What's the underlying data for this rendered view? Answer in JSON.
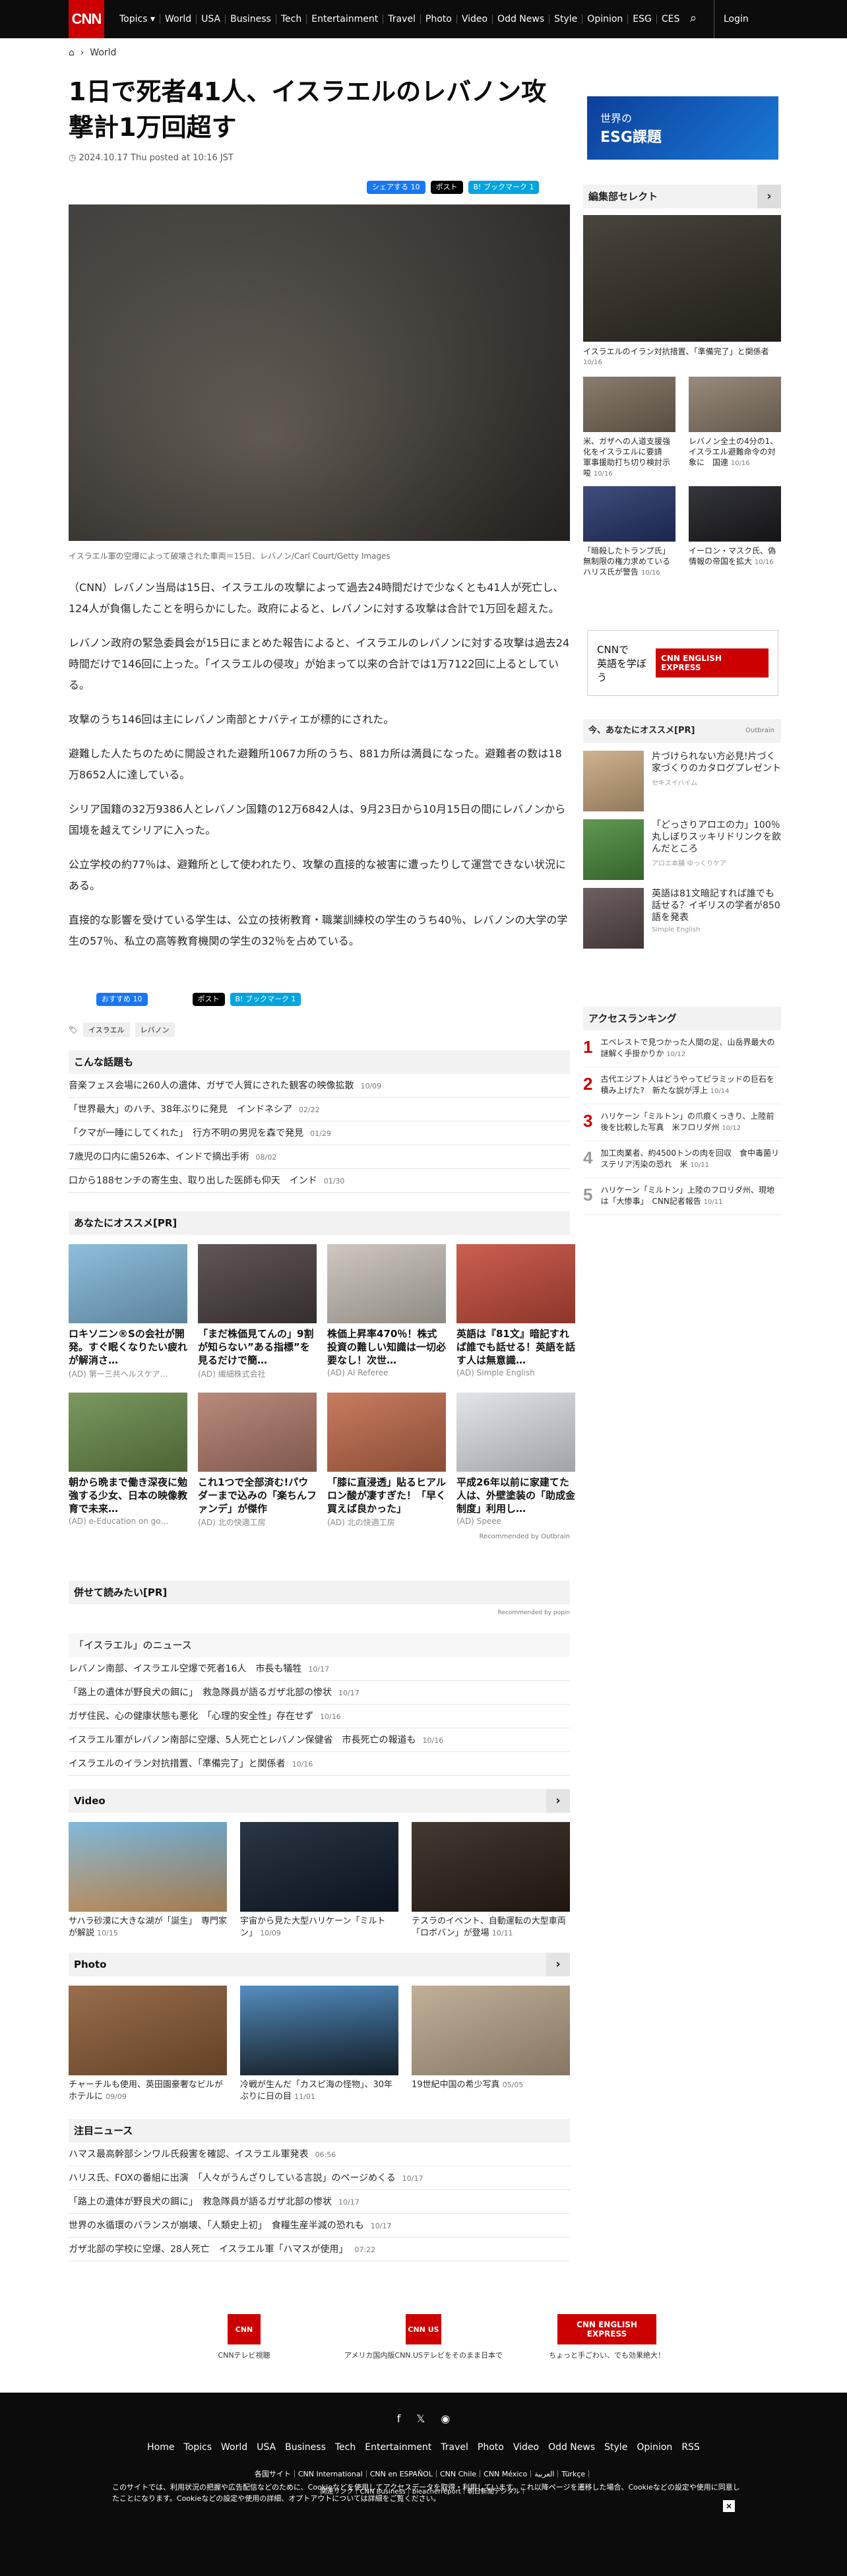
{
  "header": {
    "logo": "CNN",
    "nav": [
      "Topics",
      "World",
      "USA",
      "Business",
      "Tech",
      "Entertainment",
      "Travel",
      "Photo",
      "Video",
      "Odd News",
      "Style",
      "Opinion",
      "ESG",
      "CES"
    ],
    "login": "Login"
  },
  "breadcrumb": {
    "section": "World"
  },
  "article": {
    "title": "1日で死者41人、イスラエルのレバノン攻撃計1万回超す",
    "date": "2024.10.17 Thu posted at 10:16 JST",
    "share": {
      "facebook": "シェアする 10",
      "x": "ポスト",
      "hatena": "B! ブックマーク 1"
    },
    "caption": "イスラエル軍の空爆によって破壊された車両＝15日、レバノン/Carl Court/Getty Images",
    "paragraphs": [
      "（CNN）レバノン当局は15日、イスラエルの攻撃によって過去24時間だけで少なくとも41人が死亡し、124人が負傷したことを明らかにした。政府によると、レバノンに対する攻撃は合計で1万回を超えた。",
      "レバノン政府の緊急委員会が15日にまとめた報告によると、イスラエルのレバノンに対する攻撃は過去24時間だけで146回に上った。「イスラエルの侵攻」が始まって以来の合計では1万7122回に上るとしている。",
      "攻撃のうち146回は主にレバノン南部とナバティエが標的にされた。",
      "避難した人たちのために開設された避難所1067カ所のうち、881カ所は満員になった。避難者の数は18万8652人に達している。",
      "シリア国籍の32万9386人とレバノン国籍の12万6842人は、9月23日から10月15日の間にレバノンから国境を越えてシリアに入った。",
      "公立学校の約77％は、避難所として使われたり、攻撃の直接的な被害に遭ったりして運営できない状況にある。",
      "直接的な影響を受けている学生は、公立の技術教育・職業訓練校の学生のうち40％、レバノンの大学の学生の57％、私立の高等教育機関の学生の32％を占めている。"
    ],
    "share2": {
      "facebook": "おすすめ 10",
      "x": "ポスト",
      "hatena": "B! ブックマーク 1"
    },
    "tags": [
      "イスラエル",
      "レバノン"
    ]
  },
  "konna": {
    "heading": "こんな話題も",
    "items": [
      {
        "t": "音楽フェス会場に260人の遺体、ガザで人質にされた観客の映像拡散",
        "d": "10/09"
      },
      {
        "t": "「世界最大」のハチ、38年ぶりに発見　インドネシア",
        "d": "02/22"
      },
      {
        "t": "「クマが一睡にしてくれた」　行方不明の男児を森で発見",
        "d": "01/29"
      },
      {
        "t": "7歳児の口内に歯526本、インドで摘出手術",
        "d": "08/02"
      },
      {
        "t": "口から188センチの寄生虫、取り出した医師も仰天　インド",
        "d": "01/30"
      }
    ]
  },
  "osusume": {
    "heading": "あなたにオススメ[PR]",
    "cards": [
      {
        "t": "ロキソニン®Sの会社が開発。すぐ眠くなりたい疲れが解消さ…",
        "s": "(AD) 第一三共ヘルスケア…"
      },
      {
        "t": "「まだ株価見てんの」9割が知らない”ある指標”を見るだけで簡…",
        "s": "(AD) 繊細株式会社"
      },
      {
        "t": "株価上昇率470％！株式投資の難しい知識は一切必要なし！次世…",
        "s": "(AD) AI Referee"
      },
      {
        "t": "英語は『81文』暗記すれば誰でも話せる！英語を話す人は無意識…",
        "s": "(AD) Simple English"
      },
      {
        "t": "朝から晩まで働き深夜に勉強する少女、日本の映像教育で未来…",
        "s": "(AD) e-Education on go…"
      },
      {
        "t": "これ1つで全部済む!パウダーまで込みの「楽ちんファンデ」が傑作",
        "s": "(AD) 北の快適工房"
      },
      {
        "t": "「膝に直浸透」貼るヒアルロン酸が凄すぎた！「早く買えば良かった」",
        "s": "(AD) 北の快適工房"
      },
      {
        "t": "平成26年以前に家建てた人は、外壁塗装の「助成金制度」利用し…",
        "s": "(AD) Speee"
      }
    ],
    "recommended": "Recommended by Outbrain"
  },
  "awase": {
    "heading": "併せて読みたい[PR]",
    "recommended": "Recommended by popin"
  },
  "israel": {
    "heading": "「イスラエル」のニュース",
    "items": [
      {
        "t": "レバノン南部、イスラエル空爆で死者16人　市長も犠牲",
        "d": "10/17"
      },
      {
        "t": "「路上の遺体が野良犬の餌に」　救急隊員が語るガザ北部の惨状",
        "d": "10/17"
      },
      {
        "t": "ガザ住民、心の健康状態も悪化　「心理的安全性」存在せず",
        "d": "10/16"
      },
      {
        "t": "イスラエル軍がレバノン南部に空爆、5人死亡とレバノン保健省　市長死亡の報道も",
        "d": "10/16"
      },
      {
        "t": "イスラエルのイラン対抗措置、「準備完了」と関係者",
        "d": "10/16"
      }
    ]
  },
  "video": {
    "heading": "Video",
    "items": [
      {
        "t": "サハラ砂漠に大きな湖が「誕生」　専門家が解説",
        "d": "10/15"
      },
      {
        "t": "宇宙から見た大型ハリケーン「ミルトン」",
        "d": "10/09"
      },
      {
        "t": "テスラのイベント、自動運転の大型車両「ロボバン」が登場",
        "d": "10/11"
      }
    ]
  },
  "photo": {
    "heading": "Photo",
    "items": [
      {
        "t": "チャーチルも使用、英田園豪奢なビルがホテルに",
        "d": "09/09"
      },
      {
        "t": "冷戦が生んだ「カスピ海の怪物」、30年ぶりに日の目",
        "d": "11/01"
      },
      {
        "t": "19世紀中国の希少写真",
        "d": "05/05"
      }
    ]
  },
  "chumoku": {
    "heading": "注目ニュース",
    "items": [
      {
        "t": "ハマス最高幹部シンワル氏殺害を確認、イスラエル軍発表",
        "d": "06:56"
      },
      {
        "t": "ハリス氏、FOXの番組に出演　「人々がうんざりしている言説」のページめくる",
        "d": "10/17"
      },
      {
        "t": "「路上の遺体が野良犬の餌に」　救急隊員が語るガザ北部の惨状",
        "d": "10/17"
      },
      {
        "t": "世界の水循環のバランスが崩壊、「人類史上初」　食糧生産半減の恐れも",
        "d": "10/17"
      },
      {
        "t": "ガザ北部の学校に空爆、28人死亡　イスラエル軍「ハマスが使用」",
        "d": "07:22"
      }
    ]
  },
  "banners": [
    {
      "logo": "CNN",
      "label": "CNNテレビ視聴"
    },
    {
      "logo": "CNN US",
      "label": "アメリカ国内版CNN.USテレビをそのまま日本で"
    },
    {
      "logo": "CNN ENGLISH EXPRESS",
      "label": "ちょっと手ごわい、でも効果絶大！"
    }
  ],
  "right": {
    "esg": {
      "line1": "世界の",
      "line2": "ESG課題"
    },
    "henshu": {
      "heading": "編集部セレクト",
      "top": {
        "t": "イスラエルのイラン対抗措置、「準備完了」と関係者",
        "d": "10/16"
      },
      "items": [
        {
          "t": "米、ガザへの人道支援強化をイスラエルに要請　軍事援助打ち切り検討示唆",
          "d": "10/16"
        },
        {
          "t": "レバノン全土の4分の1、イスラエル避難命令の対象に　国連",
          "d": "10/16"
        },
        {
          "t": "「暗殺したトランプ氏」無制限の権力求めている　ハリス氏が警告",
          "d": "10/16"
        },
        {
          "t": "イーロン・マスク氏、偽情報の帝国を拡大",
          "d": "10/16"
        }
      ]
    },
    "ee": {
      "line1": "CNNで",
      "line2": "英語を学ぼう",
      "logo": "CNN ENGLISH EXPRESS"
    },
    "ob": {
      "heading": "今、あなたにオススメ[PR]",
      "brand": "Outbrain",
      "items": [
        {
          "t": "片づけられない方必見!片づく家づくりのカタログプレゼント",
          "s": "セキスイハイム"
        },
        {
          "t": "「どっさりアロエの力」100％丸しぼりスッキリドリンクを飲んだところ",
          "s": "アロエ本舗 ゆっくりケア"
        },
        {
          "t": "英語は81文暗記すれば誰でも話せる？イギリスの学者が850語を発表",
          "s": "Simple English"
        }
      ]
    },
    "rank": {
      "heading": "アクセスランキング",
      "items": [
        {
          "n": "1",
          "t": "エベレストで見つかった人間の足、山岳界最大の謎解く手掛かりか",
          "d": "10/12"
        },
        {
          "n": "2",
          "t": "古代エジプト人はどうやってピラミッドの巨石を積み上げた?　新たな説が浮上",
          "d": "10/14"
        },
        {
          "n": "3",
          "t": "ハリケーン「ミルトン」の爪痕くっきり、上陸前後を比較した写真　米フロリダ州",
          "d": "10/12"
        },
        {
          "n": "4",
          "t": "加工肉業者、約4500トンの肉を回収　食中毒菌リステリア汚染の恐れ　米",
          "d": "10/11"
        },
        {
          "n": "5",
          "t": "ハリケーン「ミルトン」上陸のフロリダ州、現地は「大惨事」　CNN記者報告",
          "d": "10/11"
        }
      ]
    }
  },
  "footer": {
    "nav": [
      "Home",
      "Topics",
      "World",
      "USA",
      "Business",
      "Tech",
      "Entertainment",
      "Travel",
      "Photo",
      "Video",
      "Odd News",
      "Style",
      "Opinion",
      "RSS"
    ],
    "sites": "各国サイト｜CNN International｜CNN en ESPAÑOL｜CNN Chile｜CNN México｜العربية｜Türkçe｜",
    "links": "関連リンク｜CNN Business｜bleacherreport｜朝日新聞デジタル｜",
    "cookie": "このサイトでは、利用状況の把握や広告配信などのために、Cookieなどを使用してアクセスデータを取得・利用しています。これ以降ページを遷移した場合、Cookieなどの設定や使用に同意したことになります。Cookieなどの設定や使用の詳細、オプトアウトについては詳細をご覧ください。",
    "close": "×"
  }
}
